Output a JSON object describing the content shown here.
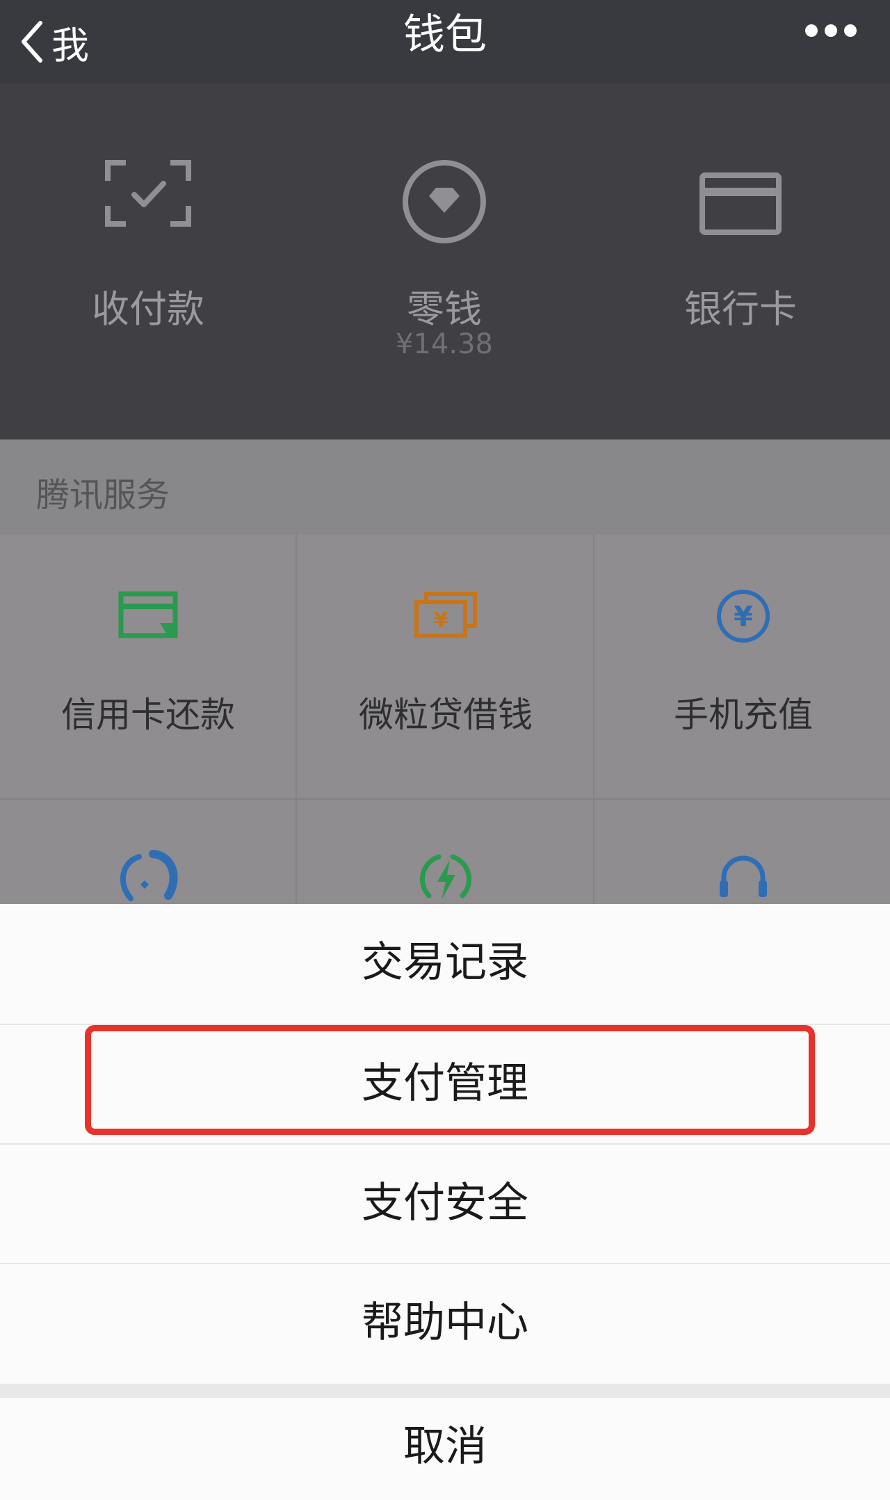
{
  "nav": {
    "back_label": "我",
    "title": "钱包"
  },
  "wallet": {
    "items": [
      {
        "label": "收付款",
        "icon": "scan-check-icon"
      },
      {
        "label": "零钱",
        "sub": "¥14.38",
        "icon": "diamond-coin-icon"
      },
      {
        "label": "银行卡",
        "icon": "bank-card-icon"
      }
    ]
  },
  "services": {
    "title": "腾讯服务",
    "items": [
      {
        "label": "信用卡还款",
        "icon": "credit-card-repay-icon",
        "color": "#2a9a4e"
      },
      {
        "label": "微粒贷借钱",
        "icon": "loan-cash-icon",
        "color": "#c8751a"
      },
      {
        "label": "手机充值",
        "icon": "phone-recharge-yuan-icon",
        "color": "#2f6db5"
      }
    ],
    "row2_icons": [
      {
        "icon": "tencent-charity-icon",
        "color": "#2f6db5"
      },
      {
        "icon": "lightning-utility-icon",
        "color": "#2a9a4e"
      },
      {
        "icon": "headset-service-icon",
        "color": "#2f6db5"
      }
    ]
  },
  "sheet": {
    "items": [
      {
        "label": "交易记录"
      },
      {
        "label": "支付管理",
        "highlighted": true
      },
      {
        "label": "支付安全"
      },
      {
        "label": "帮助中心"
      }
    ],
    "cancel_label": "取消"
  },
  "colors": {
    "nav_bg": "#393a3f",
    "wallet_bg": "#3f3f44",
    "highlight": "#e8322b"
  }
}
